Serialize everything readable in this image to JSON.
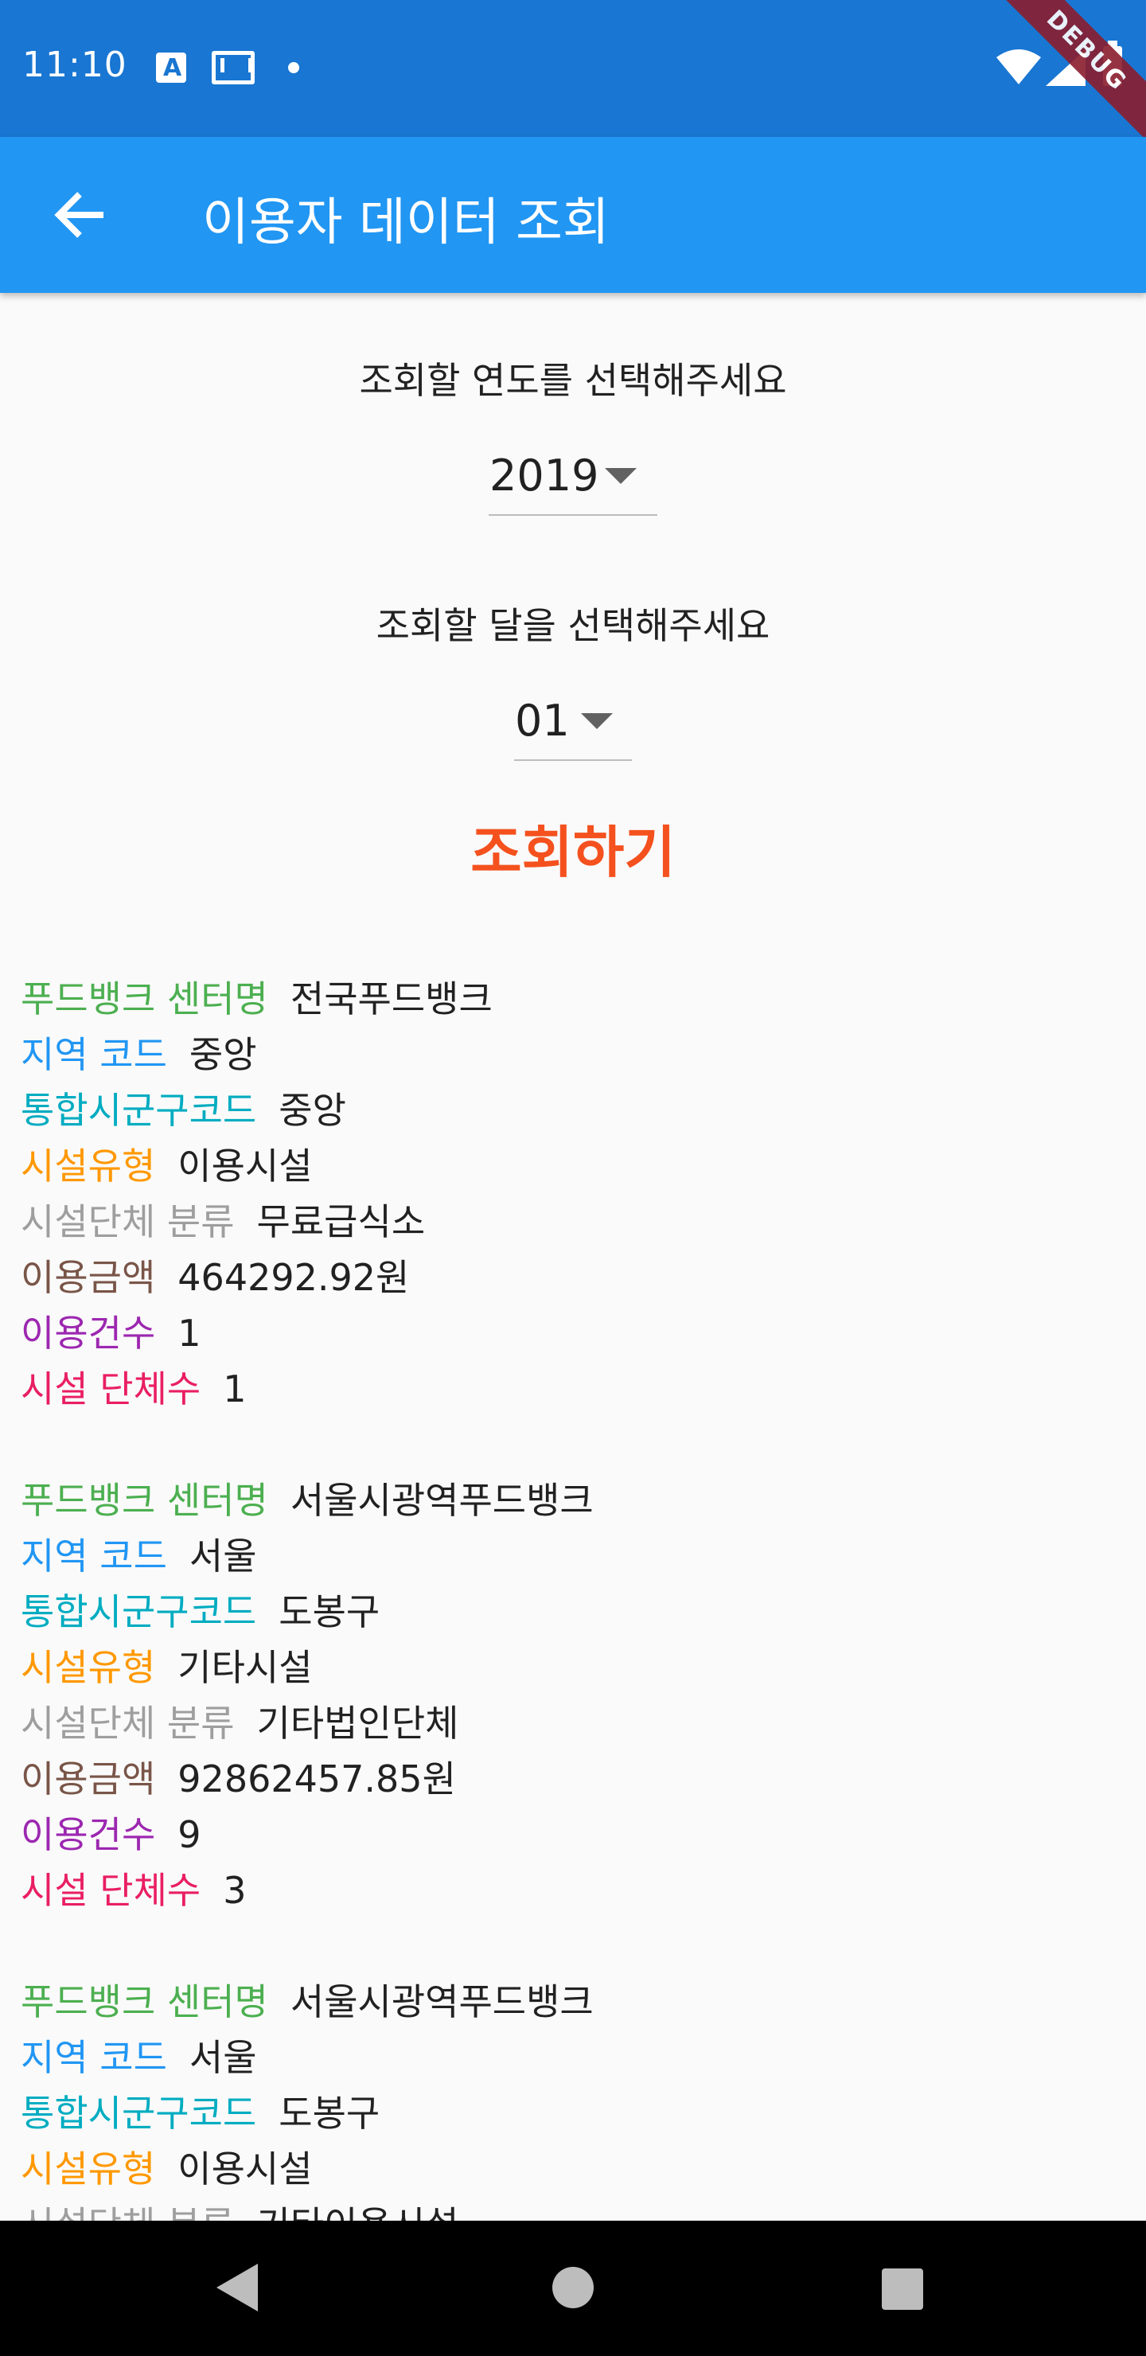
{
  "status_bar": {
    "time": "11:10",
    "debug_label": "DEBUG",
    "icons": [
      "app-notification-icon",
      "mail-icon",
      "dot-icon",
      "wifi-icon",
      "signal-icon",
      "battery-icon"
    ]
  },
  "app_bar": {
    "title": "이용자 데이터 조회",
    "back_icon": "arrow-left-icon"
  },
  "form": {
    "year_label": "조회할 연도를 선택해주세요",
    "year_value": "2019",
    "month_label": "조회할 달을 선택해주세요",
    "month_value": "01",
    "submit_label": "조회하기"
  },
  "field_labels": {
    "center": "푸드뱅크 센터명",
    "region": "지역 코드",
    "district": "통합시군구코드",
    "facility_type": "시설유형",
    "category": "시설단체 분류",
    "amount": "이용금액",
    "count": "이용건수",
    "groups": "시설 단체수"
  },
  "records": [
    {
      "center": "전국푸드뱅크",
      "region": "중앙",
      "district": "중앙",
      "facility_type": "이용시설",
      "category": "무료급식소",
      "amount": "464292.92원",
      "count": "1",
      "groups": "1"
    },
    {
      "center": "서울시광역푸드뱅크",
      "region": "서울",
      "district": "도봉구",
      "facility_type": "기타시설",
      "category": "기타법인단체",
      "amount": "92862457.85원",
      "count": "9",
      "groups": "3"
    },
    {
      "center": "서울시광역푸드뱅크",
      "region": "서울",
      "district": "도봉구",
      "facility_type": "이용시설",
      "category": "기타이용시설",
      "amount": "",
      "count": "",
      "groups": ""
    }
  ],
  "colors": {
    "status_bar": "#1976d2",
    "app_bar": "#2196f3",
    "submit": "#f4511e",
    "center_label": "#4caf50",
    "region_label": "#2196f3",
    "district_label": "#00acc1",
    "facility_type_label": "#ff9800",
    "category_label": "#9e9e9e",
    "amount_label": "#795548",
    "count_label": "#9c27b0",
    "groups_label": "#e91e63"
  },
  "nav_bar": {
    "icons": [
      "nav-back-icon",
      "nav-home-icon",
      "nav-recents-icon"
    ]
  }
}
